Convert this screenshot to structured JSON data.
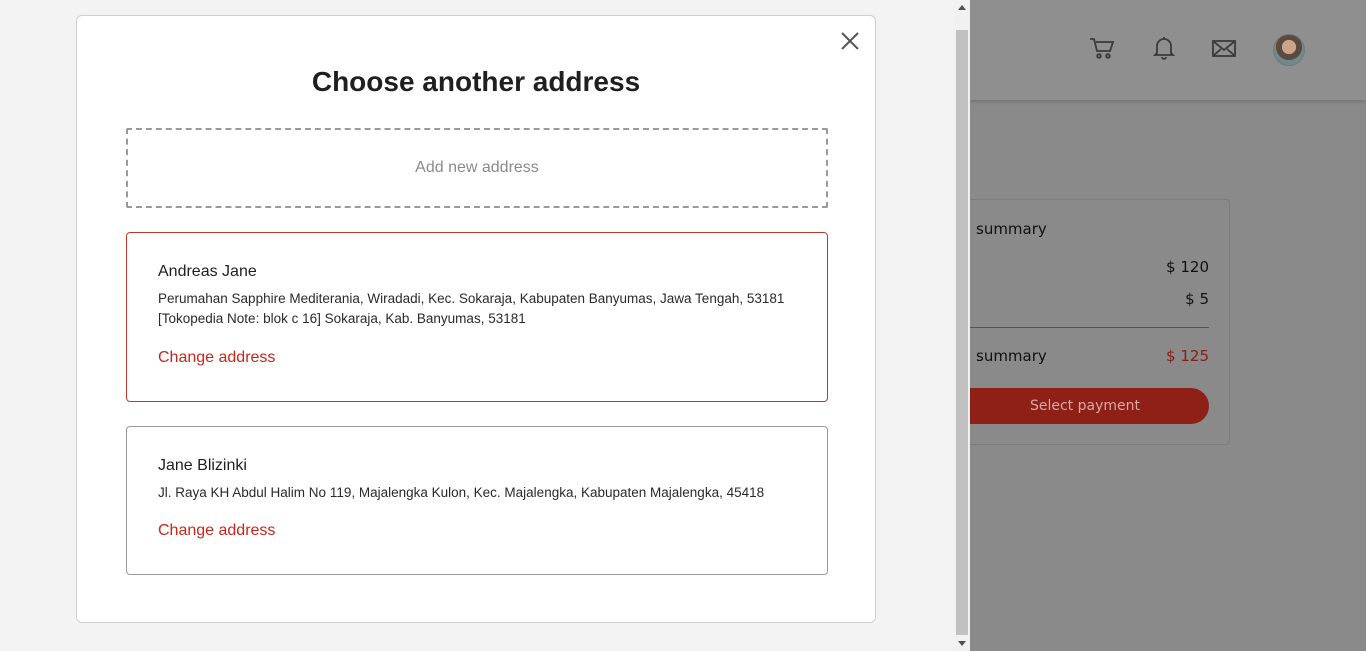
{
  "background": {
    "summary": {
      "title": "summary",
      "row1_value": "$ 120",
      "row2_value": "$ 5",
      "total_label": "summary",
      "total_value": "$ 125",
      "pay_button": "Select payment"
    }
  },
  "modal": {
    "title": "Choose another address",
    "add_new_label": "Add new address",
    "addresses": [
      {
        "name": "Andreas Jane",
        "text": "Perumahan Sapphire Mediterania, Wiradadi, Kec. Sokaraja, Kabupaten Banyumas, Jawa Tengah, 53181 [Tokopedia Note: blok c 16] Sokaraja, Kab. Banyumas, 53181",
        "change_label": "Change address",
        "selected": true
      },
      {
        "name": "Jane Blizinki",
        "text": "Jl. Raya KH Abdul Halim No 119, Majalengka Kulon, Kec. Majalengka, Kabupaten Majalengka, 45418",
        "change_label": "Change address",
        "selected": false
      }
    ]
  },
  "colors": {
    "accent": "#c8261b",
    "selected_border": "#c0392b"
  },
  "icons": [
    "cart-icon",
    "bell-icon",
    "mail-icon",
    "close-icon"
  ]
}
